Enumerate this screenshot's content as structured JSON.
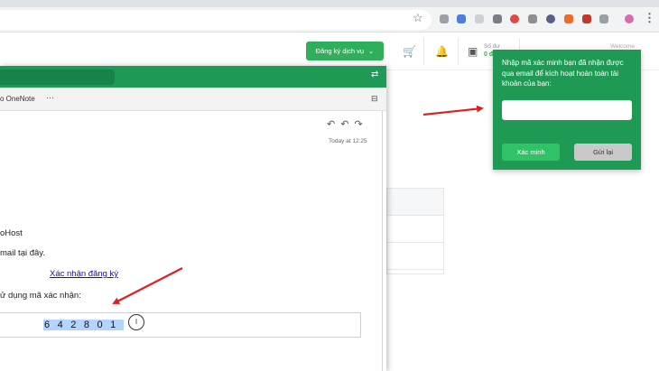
{
  "header": {
    "register_label": "Đăng ký dịch vụ",
    "balance_label": "Số dư",
    "balance_value": "0 đ",
    "welcome": "Welcome"
  },
  "mail": {
    "ribbon_item": "o OneNote",
    "more_label": "···",
    "timestamp": "Today at 12:25",
    "line1": "oHost",
    "line2": "mail tại đây.",
    "confirm_link": "Xác nhận đăng ký",
    "line3": "ử dụng mã xác nhận:",
    "code": "642801"
  },
  "verify": {
    "prompt": "Nhập mã xác minh bạn đã nhận được qua email để kích hoạt hoàn toàn tài khoản của bạn:",
    "input_value": "",
    "verify_label": "Xác minh",
    "resend_label": "Gửi lại"
  },
  "colors": {
    "brand_green": "#1f9a55",
    "button_green": "#2fae5b",
    "arrow_red": "#e02020",
    "link_blue": "#1a0dab"
  },
  "icons": [
    "star-icon",
    "cart-icon",
    "bell-icon",
    "wallet-icon",
    "reply-icon",
    "reply-all-icon",
    "forward-icon",
    "text-cursor-icon",
    "chevron-down-icon"
  ]
}
